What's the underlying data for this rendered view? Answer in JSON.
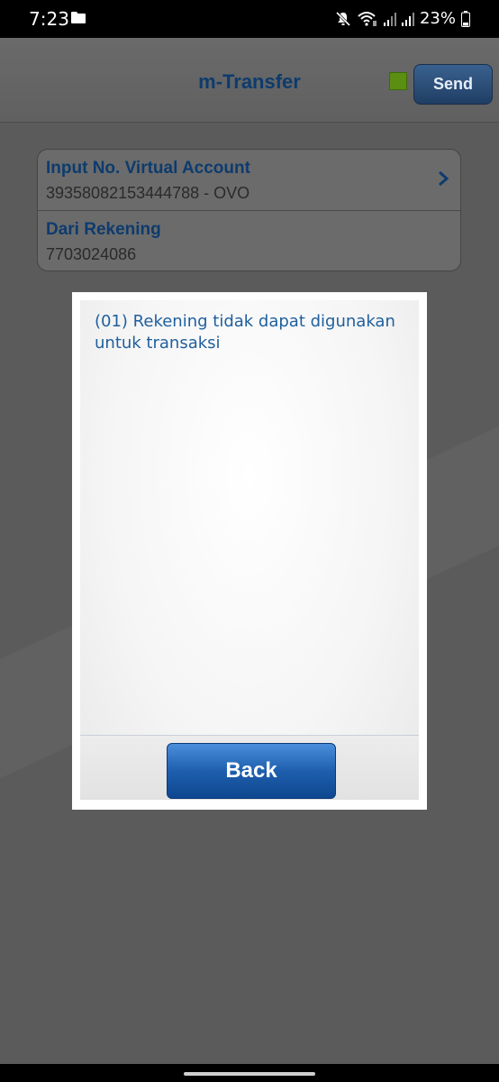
{
  "status_bar": {
    "time": "7:23",
    "battery_percent": "23%",
    "icons": [
      "folder-icon",
      "mute-icon",
      "wifi-icon",
      "signal-icon",
      "signal-icon",
      "battery-icon"
    ]
  },
  "header": {
    "title": "m-Transfer",
    "send_label": "Send",
    "status_color": "#5b8f12"
  },
  "form": {
    "va_label": "Input No. Virtual Account",
    "va_value": "39358082153444788 - OVO",
    "from_label": "Dari Rekening",
    "from_value": "7703024086"
  },
  "dialog": {
    "message": "(01) Rekening tidak dapat digunakan untuk transaksi",
    "back_label": "Back"
  },
  "colors": {
    "accent_blue": "#0d3b6e",
    "message_blue": "#1f5f9e",
    "button_blue": "#1e5fae"
  }
}
